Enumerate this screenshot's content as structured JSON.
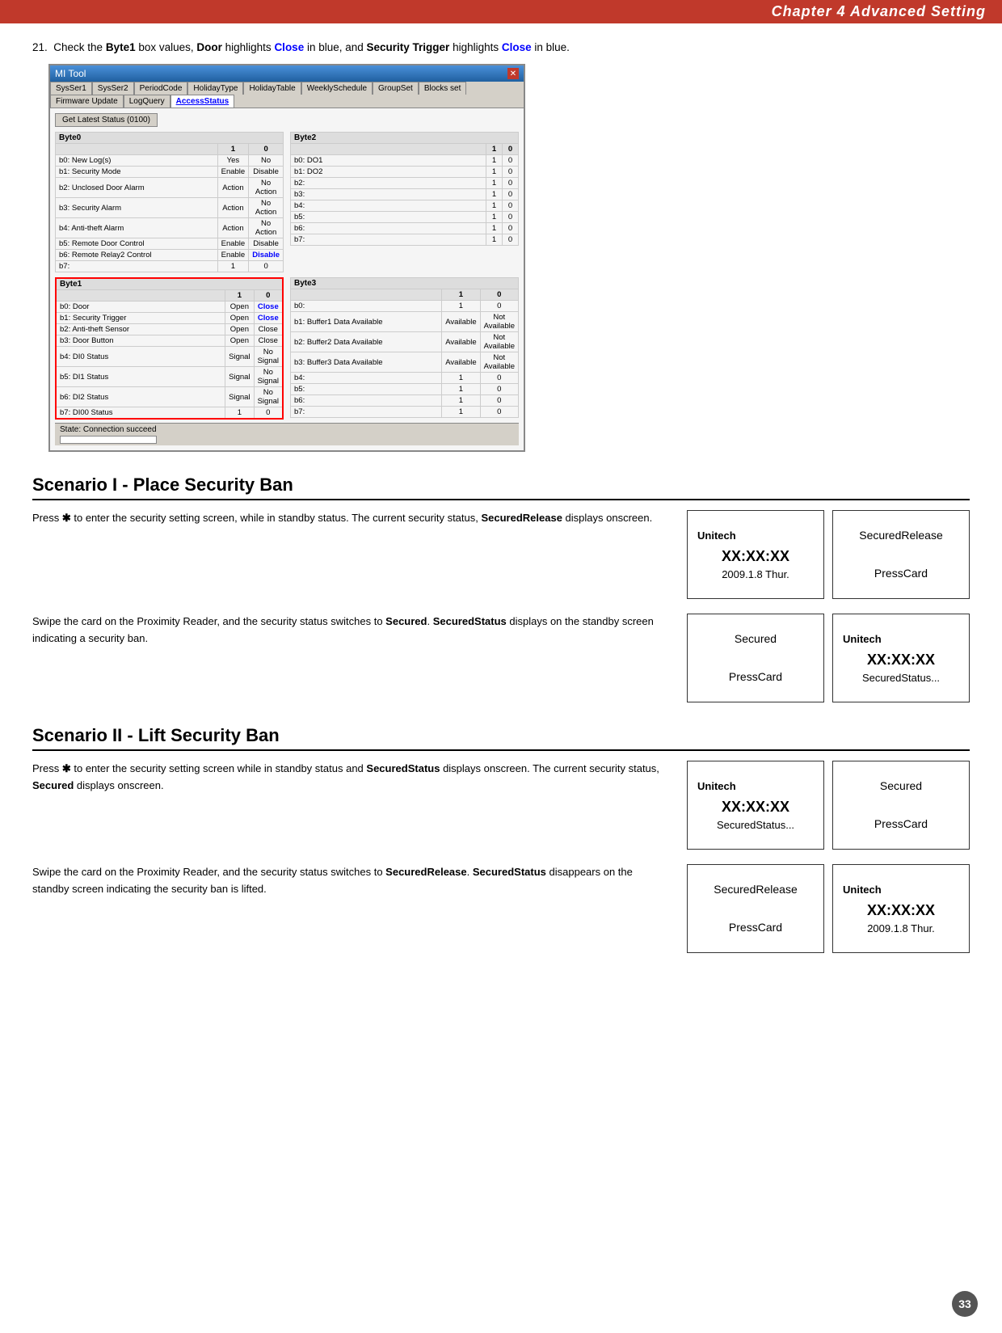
{
  "header": {
    "text": "Chapter 4  Advanced Setting"
  },
  "step21": {
    "text": "Check the Byte1 box values, Door highlights Close in blue, and Security Trigger highlights Close in blue."
  },
  "mitool": {
    "title": "MI Tool",
    "tabs": [
      "SysSer1",
      "SysSer2",
      "PeriodCode",
      "HolidayType",
      "HolidayTable",
      "WeeklySchedule",
      "GroupSet",
      "Blocks set",
      "Firmware Update",
      "LogQuery",
      "AccessStatus"
    ],
    "activeTab": "AccessStatus",
    "buttonLabel": "Get Latest Status (0100)",
    "byte0": {
      "header": "Byte0",
      "rows": [
        {
          "label": "b0: New Log(s)",
          "v1": "Yes",
          "v0": "No"
        },
        {
          "label": "b1: Security Mode",
          "v1": "Enable",
          "v0": "Disable"
        },
        {
          "label": "b2: Unclosed Door Alarm",
          "v1": "Action",
          "v0": "No Action"
        },
        {
          "label": "b3: Security Alarm",
          "v1": "Action",
          "v0": "No Action"
        },
        {
          "label": "b4: Anti-theft Alarm",
          "v1": "Action",
          "v0": "No Action"
        },
        {
          "label": "b5: Remote Door Control",
          "v1": "Enable",
          "v0": "Disable"
        },
        {
          "label": "b6: Remote Relay2 Control",
          "v1": "Enable",
          "v0": "Disable"
        },
        {
          "label": "b7:",
          "v1": "1",
          "v0": "0"
        }
      ]
    },
    "byte1": {
      "header": "Byte1",
      "rows": [
        {
          "label": "b0: Door",
          "v1": "Open",
          "v0": "Close"
        },
        {
          "label": "b1: Security Trigger",
          "v1": "Open",
          "v0": "Close"
        },
        {
          "label": "b2: Anti-theft Sensor",
          "v1": "Open",
          "v0": "Close"
        },
        {
          "label": "b3: Door Button",
          "v1": "Open",
          "v0": "Close"
        },
        {
          "label": "b4: DI0 Status",
          "v1": "Signal",
          "v0": "No Signal"
        },
        {
          "label": "b5: DI1 Status",
          "v1": "Signal",
          "v0": "No Signal"
        },
        {
          "label": "b6: DI2 Status",
          "v1": "Signal",
          "v0": "No Signal"
        },
        {
          "label": "b7: DI00 Status",
          "v1": "1",
          "v0": "0"
        }
      ]
    },
    "byte2": {
      "header": "Byte2",
      "rows": [
        {
          "label": "b0: DO1",
          "v1": "1",
          "v0": "0"
        },
        {
          "label": "b1: DO2",
          "v1": "1",
          "v0": "0"
        },
        {
          "label": "b2:",
          "v1": "1",
          "v0": "0"
        },
        {
          "label": "b3:",
          "v1": "1",
          "v0": "0"
        },
        {
          "label": "b4:",
          "v1": "1",
          "v0": "0"
        },
        {
          "label": "b5:",
          "v1": "1",
          "v0": "0"
        },
        {
          "label": "b6:",
          "v1": "1",
          "v0": "0"
        },
        {
          "label": "b7:",
          "v1": "1",
          "v0": "0"
        }
      ]
    },
    "byte3": {
      "header": "Byte3",
      "rows": [
        {
          "label": "b0:",
          "v1": "1",
          "v0": "0"
        },
        {
          "label": "b1: Buffer1 Data Available",
          "v1": "Available",
          "v0": "Not Available"
        },
        {
          "label": "b2: Buffer2 Data Available",
          "v1": "Available",
          "v0": "Not Available"
        },
        {
          "label": "b3: Buffer3 Data Available",
          "v1": "Available",
          "v0": "Not Available"
        },
        {
          "label": "b4:",
          "v1": "1",
          "v0": "0"
        },
        {
          "label": "b5:",
          "v1": "1",
          "v0": "0"
        },
        {
          "label": "b6:",
          "v1": "1",
          "v0": "0"
        },
        {
          "label": "b7:",
          "v1": "1",
          "v0": "0"
        }
      ]
    },
    "statusLabel": "State: Connection succeed"
  },
  "scenario1": {
    "title": "Scenario I - Place Security Ban",
    "block1": {
      "text": "Press ✱ to enter the security setting screen, while in standby status. The current security status, SecuredRelease displays onscreen.",
      "leftScreen": {
        "title": "Unitech",
        "line1": "XX:XX:XX",
        "line2": "2009.1.8 Thur."
      },
      "rightScreen": {
        "line1": "SecuredRelease",
        "line2": "PressCard"
      }
    },
    "block2": {
      "text": "Swipe the card on the Proximity Reader, and the security status switches to Secured. SecuredStatus displays on the standby screen indicating a security ban.",
      "leftScreen": {
        "line1": "Secured",
        "line2": "PressCard"
      },
      "rightScreen": {
        "title": "Unitech",
        "line1": "XX:XX:XX",
        "line2": "SecuredStatus..."
      }
    }
  },
  "scenario2": {
    "title": "Scenario II - Lift Security Ban",
    "block1": {
      "text": "Press ✱ to enter the security setting screen while in standby status and SecuredStatus displays onscreen. The current security status, Secured displays onscreen.",
      "leftScreen": {
        "title": "Unitech",
        "line1": "XX:XX:XX",
        "line2": "SecuredStatus..."
      },
      "rightScreen": {
        "line1": "Secured",
        "line2": "PressCard"
      }
    },
    "block2": {
      "text": "Swipe the card on the Proximity Reader, and the security status switches to SecuredRelease. SecuredStatus disappears on the standby screen indicating the security ban is lifted.",
      "leftScreen": {
        "line1": "SecuredRelease",
        "line2": "PressCard"
      },
      "rightScreen": {
        "title": "Unitech",
        "line1": "XX:XX:XX",
        "line2": "2009.1.8 Thur."
      }
    }
  },
  "pageNumber": "33"
}
